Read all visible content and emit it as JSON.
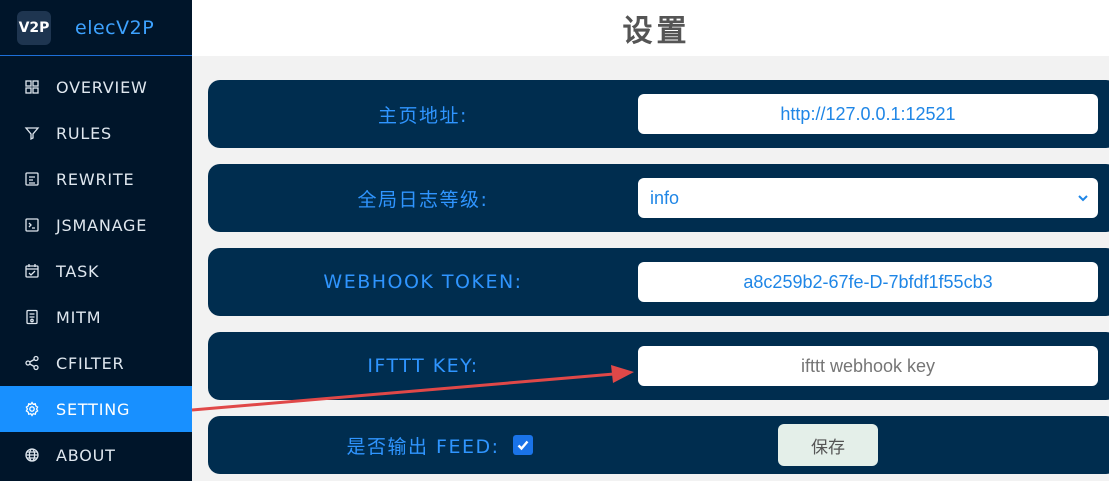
{
  "brand": {
    "logo_text": "V2P",
    "name": "elecV2P"
  },
  "sidebar": {
    "items": [
      {
        "label": "OVERVIEW",
        "icon": "grid-icon"
      },
      {
        "label": "RULES",
        "icon": "filter-icon"
      },
      {
        "label": "REWRITE",
        "icon": "rewrite-icon"
      },
      {
        "label": "JSMANAGE",
        "icon": "terminal-icon"
      },
      {
        "label": "TASK",
        "icon": "calendar-icon"
      },
      {
        "label": "MITM",
        "icon": "certificate-icon"
      },
      {
        "label": "CFILTER",
        "icon": "share-icon"
      },
      {
        "label": "SETTING",
        "icon": "gear-icon",
        "active": true
      },
      {
        "label": "ABOUT",
        "icon": "globe-icon"
      }
    ]
  },
  "header": {
    "title": "设置"
  },
  "settings": {
    "homepage": {
      "label": "主页地址:",
      "value": "http://127.0.0.1:12521"
    },
    "loglevel": {
      "label": "全局日志等级:",
      "value": "info"
    },
    "webhook": {
      "label": "WEBHOOK TOKEN:",
      "value": "a8c259b2-67fe-D-7bfdf1f55cb3"
    },
    "ifttt": {
      "label": "IFTTT KEY:",
      "value": "ifttt webhook key"
    },
    "feed": {
      "label": "是否输出 FEED:",
      "checked": true,
      "save_label": "保存"
    }
  },
  "colors": {
    "sidebar_bg": "#00152a",
    "active_item": "#1890ff",
    "row_bg": "#002d4f",
    "label_text": "#2f95ff",
    "annotation_arrow": "#e04848"
  }
}
